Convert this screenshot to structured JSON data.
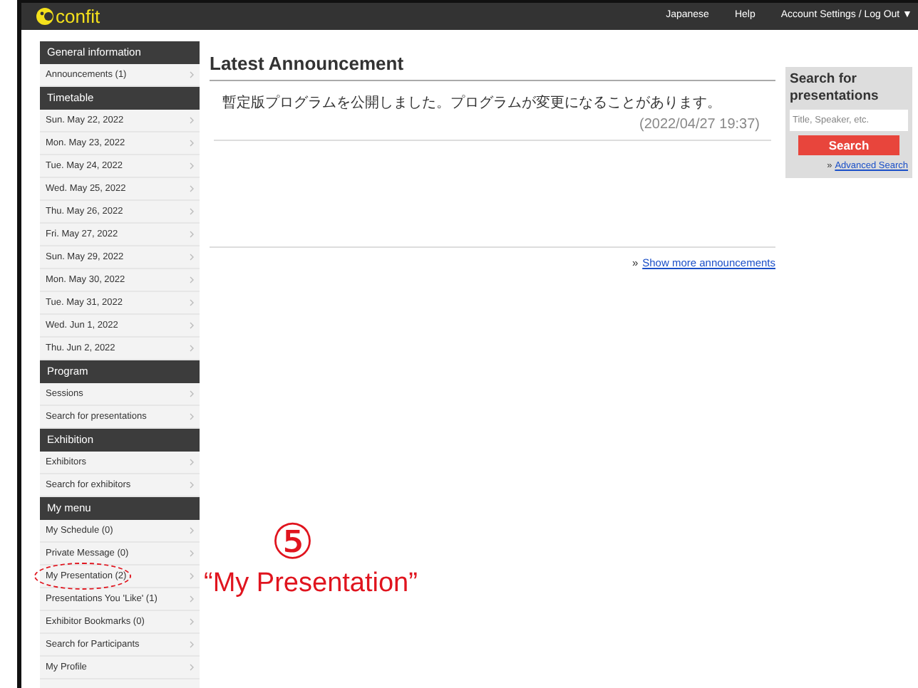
{
  "header": {
    "logo": "confit",
    "links": [
      "Japanese",
      "Help",
      "Account Settings / Log Out ▼"
    ]
  },
  "sidebar": [
    {
      "kind": "header",
      "label": "General information"
    },
    {
      "kind": "item",
      "label": "Announcements (1)"
    },
    {
      "kind": "header",
      "label": "Timetable"
    },
    {
      "kind": "item",
      "label": "Sun. May 22, 2022"
    },
    {
      "kind": "item",
      "label": "Mon. May 23, 2022"
    },
    {
      "kind": "item",
      "label": "Tue. May 24, 2022"
    },
    {
      "kind": "item",
      "label": "Wed. May 25, 2022"
    },
    {
      "kind": "item",
      "label": "Thu. May 26, 2022"
    },
    {
      "kind": "item",
      "label": "Fri. May 27, 2022"
    },
    {
      "kind": "item",
      "label": "Sun. May 29, 2022"
    },
    {
      "kind": "item",
      "label": "Mon. May 30, 2022"
    },
    {
      "kind": "item",
      "label": "Tue. May 31, 2022"
    },
    {
      "kind": "item",
      "label": "Wed. Jun 1, 2022"
    },
    {
      "kind": "item",
      "label": "Thu. Jun 2, 2022"
    },
    {
      "kind": "header",
      "label": "Program"
    },
    {
      "kind": "item",
      "label": "Sessions"
    },
    {
      "kind": "item",
      "label": "Search for presentations"
    },
    {
      "kind": "header",
      "label": "Exhibition"
    },
    {
      "kind": "item",
      "label": "Exhibitors"
    },
    {
      "kind": "item",
      "label": "Search for exhibitors"
    },
    {
      "kind": "header",
      "label": "My menu"
    },
    {
      "kind": "item",
      "label": "My Schedule (0)"
    },
    {
      "kind": "item",
      "label": "Private Message (0)"
    },
    {
      "kind": "item",
      "label": "My Presentation (2)",
      "circled": true
    },
    {
      "kind": "item",
      "label": "Presentations You 'Like' (1)"
    },
    {
      "kind": "item",
      "label": "Exhibitor Bookmarks (0)"
    },
    {
      "kind": "item",
      "label": "Search for Participants"
    },
    {
      "kind": "item",
      "label": "My Profile"
    }
  ],
  "main": {
    "title": "Latest Announcement",
    "announcements": [
      {
        "text": "暫定版プログラムを公開しました。プログラムが変更になることがあります。",
        "time": "(2022/04/27 19:37)"
      }
    ],
    "more_link": "Show more announcements",
    "more_prefix": "»"
  },
  "search_panel": {
    "title": "Search for presentations",
    "placeholder": "Title, Speaker, etc.",
    "button": "Search",
    "advanced_prefix": "»",
    "advanced_link": "Advanced Search"
  },
  "annotation": {
    "number": "⑤",
    "label": "“My Presentation”"
  }
}
